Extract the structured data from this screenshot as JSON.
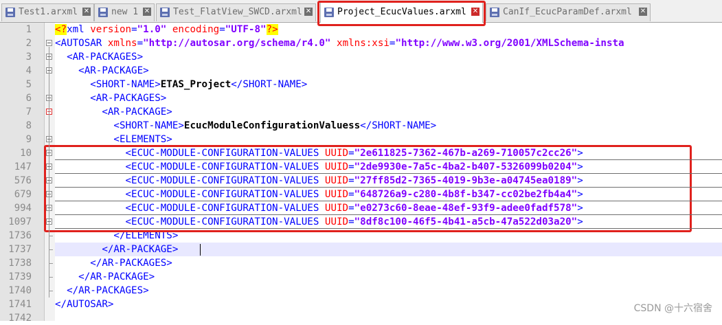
{
  "tabs": [
    {
      "label": "Test1.arxml",
      "close": "✕",
      "active": false
    },
    {
      "label": "new 1",
      "close": "✕",
      "active": false
    },
    {
      "label": "Test_FlatView_SWCD.arxml",
      "close": "✕",
      "active": false
    },
    {
      "label": "Project_EcucValues.arxml",
      "close": "✕",
      "active": true
    },
    {
      "label": "CanIf_EcucParamDef.arxml",
      "close": "✕",
      "active": false
    }
  ],
  "editor": {
    "lines": [
      {
        "num": "1",
        "indent": "",
        "segments": [
          {
            "c": "d",
            "t": "<?"
          },
          {
            "c": "t",
            "t": "xml "
          },
          {
            "c": "a",
            "t": "version"
          },
          {
            "c": "t",
            "t": "="
          },
          {
            "c": "v",
            "t": "\"1.0\""
          },
          {
            "c": "t",
            "t": " "
          },
          {
            "c": "a",
            "t": "encoding"
          },
          {
            "c": "t",
            "t": "="
          },
          {
            "c": "v",
            "t": "\"UTF-8\""
          },
          {
            "c": "d",
            "t": "?>"
          }
        ]
      },
      {
        "num": "2",
        "indent": "",
        "segments": [
          {
            "c": "t",
            "t": "<AUTOSAR "
          },
          {
            "c": "a",
            "t": "xmlns"
          },
          {
            "c": "t",
            "t": "="
          },
          {
            "c": "v",
            "t": "\"http://autosar.org/schema/r4.0\""
          },
          {
            "c": "t",
            "t": " "
          },
          {
            "c": "a",
            "t": "xmlns:xsi"
          },
          {
            "c": "t",
            "t": "="
          },
          {
            "c": "v",
            "t": "\"http://www.w3.org/2001/XMLSchema-insta"
          }
        ]
      },
      {
        "num": "3",
        "indent": "  ",
        "segments": [
          {
            "c": "t",
            "t": "<AR-PACKAGES>"
          }
        ]
      },
      {
        "num": "4",
        "indent": "    ",
        "segments": [
          {
            "c": "t",
            "t": "<AR-PACKAGE>"
          }
        ]
      },
      {
        "num": "5",
        "indent": "      ",
        "segments": [
          {
            "c": "t",
            "t": "<SHORT-NAME>"
          },
          {
            "c": "b",
            "t": "ETAS_Project"
          },
          {
            "c": "t",
            "t": "</SHORT-NAME>"
          }
        ]
      },
      {
        "num": "6",
        "indent": "      ",
        "segments": [
          {
            "c": "t",
            "t": "<AR-PACKAGES>"
          }
        ]
      },
      {
        "num": "7",
        "indent": "        ",
        "segments": [
          {
            "c": "t",
            "t": "<AR-PACKAGE>"
          }
        ]
      },
      {
        "num": "8",
        "indent": "          ",
        "segments": [
          {
            "c": "t",
            "t": "<SHORT-NAME>"
          },
          {
            "c": "b",
            "t": "EcucModuleConfigurationValuess"
          },
          {
            "c": "t",
            "t": "</SHORT-NAME>"
          }
        ]
      },
      {
        "num": "9",
        "indent": "          ",
        "segments": [
          {
            "c": "t",
            "t": "<ELEMENTS>"
          }
        ]
      },
      {
        "num": "10",
        "indent": "            ",
        "segments": [
          {
            "c": "t",
            "t": "<ECUC-MODULE-CONFIGURATION-VALUES "
          },
          {
            "c": "a",
            "t": "UUID"
          },
          {
            "c": "t",
            "t": "="
          },
          {
            "c": "v",
            "t": "\"2e611825-7362-467b-a269-710057c2cc26\""
          },
          {
            "c": "t",
            "t": ">"
          }
        ]
      },
      {
        "num": "147",
        "indent": "            ",
        "segments": [
          {
            "c": "t",
            "t": "<ECUC-MODULE-CONFIGURATION-VALUES "
          },
          {
            "c": "a",
            "t": "UUID"
          },
          {
            "c": "t",
            "t": "="
          },
          {
            "c": "v",
            "t": "\"2de9930e-7a5c-4ba2-b407-5326099b0204\""
          },
          {
            "c": "t",
            "t": ">"
          }
        ]
      },
      {
        "num": "576",
        "indent": "            ",
        "segments": [
          {
            "c": "t",
            "t": "<ECUC-MODULE-CONFIGURATION-VALUES "
          },
          {
            "c": "a",
            "t": "UUID"
          },
          {
            "c": "t",
            "t": "="
          },
          {
            "c": "v",
            "t": "\"27ff85d2-7365-4019-9b3e-a04745ea0189\""
          },
          {
            "c": "t",
            "t": ">"
          }
        ]
      },
      {
        "num": "679",
        "indent": "            ",
        "segments": [
          {
            "c": "t",
            "t": "<ECUC-MODULE-CONFIGURATION-VALUES "
          },
          {
            "c": "a",
            "t": "UUID"
          },
          {
            "c": "t",
            "t": "="
          },
          {
            "c": "v",
            "t": "\"648726a9-c280-4b8f-b347-cc02be2fb4a4\""
          },
          {
            "c": "t",
            "t": ">"
          }
        ]
      },
      {
        "num": "994",
        "indent": "            ",
        "segments": [
          {
            "c": "t",
            "t": "<ECUC-MODULE-CONFIGURATION-VALUES "
          },
          {
            "c": "a",
            "t": "UUID"
          },
          {
            "c": "t",
            "t": "="
          },
          {
            "c": "v",
            "t": "\"e0273c60-8eae-48ef-93f9-adee0fadf578\""
          },
          {
            "c": "t",
            "t": ">"
          }
        ]
      },
      {
        "num": "1097",
        "indent": "            ",
        "segments": [
          {
            "c": "t",
            "t": "<ECUC-MODULE-CONFIGURATION-VALUES "
          },
          {
            "c": "a",
            "t": "UUID"
          },
          {
            "c": "t",
            "t": "="
          },
          {
            "c": "v",
            "t": "\"8df8c100-46f5-4b41-a5cb-47a522d03a20\""
          },
          {
            "c": "t",
            "t": ">"
          }
        ]
      },
      {
        "num": "1736",
        "indent": "          ",
        "segments": [
          {
            "c": "t",
            "t": "</ELEMENTS>"
          }
        ]
      },
      {
        "num": "1737",
        "indent": "        ",
        "segments": [
          {
            "c": "t",
            "t": "</AR-PACKAGE>"
          }
        ]
      },
      {
        "num": "1738",
        "indent": "      ",
        "segments": [
          {
            "c": "t",
            "t": "</AR-PACKAGES>"
          }
        ]
      },
      {
        "num": "1739",
        "indent": "    ",
        "segments": [
          {
            "c": "t",
            "t": "</AR-PACKAGE>"
          }
        ]
      },
      {
        "num": "1740",
        "indent": "  ",
        "segments": [
          {
            "c": "t",
            "t": "</AR-PACKAGES>"
          }
        ]
      },
      {
        "num": "1741",
        "indent": "",
        "segments": [
          {
            "c": "t",
            "t": "</AUTOSAR>"
          }
        ]
      },
      {
        "num": "1742",
        "indent": "",
        "segments": []
      }
    ]
  },
  "watermark": "CSDN @十六宿舍",
  "colors": {
    "highlight": "#e0211d",
    "tag": "#0000ff",
    "attr": "#ff0000",
    "value": "#8000ff"
  },
  "icons": {
    "tab_file": "file-icon",
    "tab_close": "close-icon"
  }
}
